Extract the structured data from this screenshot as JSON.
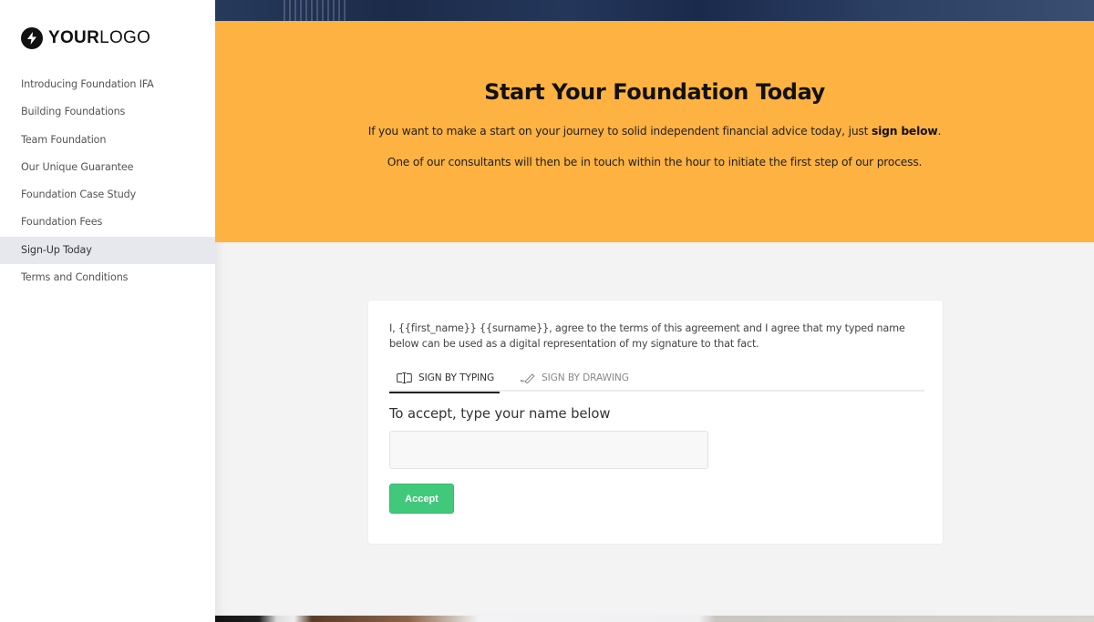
{
  "brand": {
    "logo_bold": "YOUR",
    "logo_light": "LOGO",
    "icon": "lightning-bolt-icon"
  },
  "sidebar": {
    "items": [
      {
        "label": "Introducing Foundation IFA",
        "active": false
      },
      {
        "label": "Building Foundations",
        "active": false
      },
      {
        "label": "Team Foundation",
        "active": false
      },
      {
        "label": "Our Unique Guarantee",
        "active": false
      },
      {
        "label": "Foundation Case Study",
        "active": false
      },
      {
        "label": "Foundation Fees",
        "active": false
      },
      {
        "label": "Sign-Up Today",
        "active": true
      },
      {
        "label": "Terms and Conditions",
        "active": false
      }
    ]
  },
  "hero": {
    "title": "Start Your Foundation Today",
    "line1_prefix": "If you want to make a start on your journey to solid independent financial advice today, just ",
    "line1_bold": "sign below",
    "line1_suffix": ".",
    "line2": "One of our consultants will then be in touch within the hour to initiate the first step of our process.",
    "background_color": "#feb241"
  },
  "signature": {
    "agreement_text": "I, {{first_name}} {{surname}}, agree to the terms of this agreement and I agree that my typed name below can be used as a digital representation of my signature to that fact.",
    "tabs": [
      {
        "label": "SIGN BY TYPING",
        "icon": "text-cursor-icon",
        "active": true
      },
      {
        "label": "SIGN BY DRAWING",
        "icon": "pen-icon",
        "active": false
      }
    ],
    "input_label": "To accept, type your name below",
    "input_value": "",
    "input_placeholder": "",
    "accept_label": "Accept",
    "accept_color": "#41c97b"
  }
}
